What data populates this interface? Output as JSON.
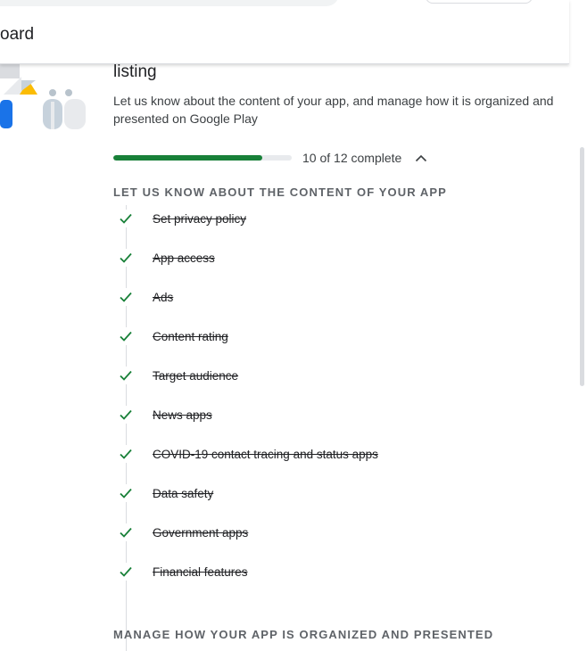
{
  "header": {
    "page_title": "oard"
  },
  "card": {
    "heading": "listing",
    "description": "Let us know about the content of your app, and manage how it is organized and presented on Google Play",
    "progress": {
      "completed": 10,
      "total": 12,
      "text": "10 of 12 complete"
    }
  },
  "sections": [
    {
      "title": "LET US KNOW ABOUT THE CONTENT OF YOUR APP",
      "tasks": [
        {
          "label": "Set privacy policy",
          "done": true
        },
        {
          "label": "App access",
          "done": true
        },
        {
          "label": "Ads",
          "done": true
        },
        {
          "label": "Content rating",
          "done": true
        },
        {
          "label": "Target audience",
          "done": true
        },
        {
          "label": "News apps",
          "done": true
        },
        {
          "label": "COVID-19 contact tracing and status apps",
          "done": true
        },
        {
          "label": "Data safety",
          "done": true
        },
        {
          "label": "Government apps",
          "done": true
        },
        {
          "label": "Financial features",
          "done": true
        }
      ]
    },
    {
      "title": "MANAGE HOW YOUR APP IS ORGANIZED AND PRESENTED"
    }
  ],
  "icons": {
    "check": "check-icon",
    "collapse": "chevron-up-icon"
  },
  "colors": {
    "check": "#188038",
    "progress": "#188038",
    "progress_track": "#e8eaed",
    "section_header": "#5f6368"
  }
}
